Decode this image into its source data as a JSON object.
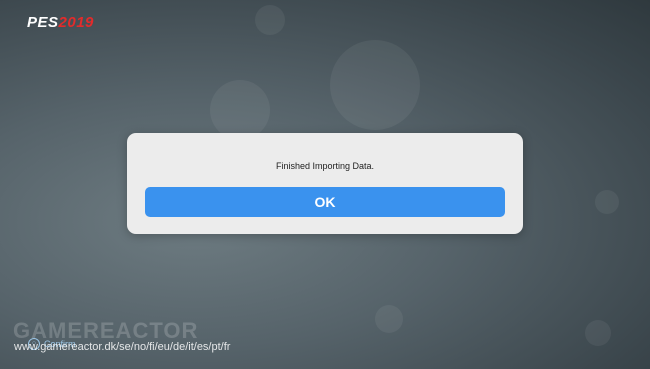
{
  "logo": {
    "brand": "PES",
    "year": "2019"
  },
  "dialog": {
    "message": "Finished Importing Data.",
    "ok_label": "OK"
  },
  "prompt": {
    "key_icon": "circle-button-icon",
    "label": "Confirm"
  },
  "watermark": {
    "logo": "GAMEREACTOR",
    "url": "www.gamereactor.dk/se/no/fi/eu/de/it/es/pt/fr"
  }
}
